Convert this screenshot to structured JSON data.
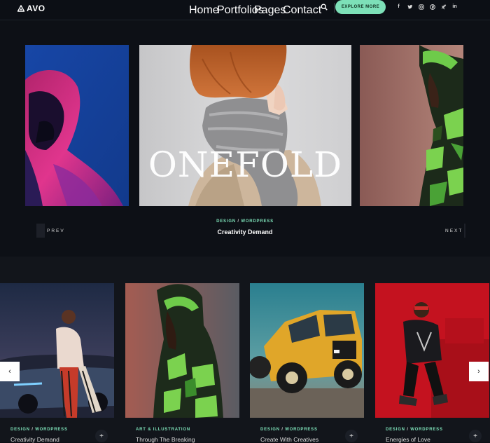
{
  "brand": {
    "logo_text": "AVO"
  },
  "nav": {
    "items": [
      "Home",
      "Portfolios",
      "Pages",
      "Contact"
    ],
    "cta_label": "EXPLORE MORE",
    "socials": [
      "facebook-icon",
      "twitter-icon",
      "instagram-icon",
      "pinterest-icon",
      "xing-icon",
      "linkedin-icon"
    ]
  },
  "hero": {
    "center_overlay": "ONEFOLD",
    "category_1": "DESIGN",
    "separator": "/",
    "category_2": "WORDPRESS",
    "title": "Creativity Demand",
    "prev_label": "PREV",
    "next_label": "NEXT"
  },
  "cards": [
    {
      "cat1": "DESIGN",
      "sep": "/",
      "cat2": "WORDPRESS",
      "title": "Creativity Demand"
    },
    {
      "cat1": "ART & ILLUSTRATION",
      "sep": "",
      "cat2": "",
      "title": "Through The Breaking"
    },
    {
      "cat1": "DESIGN",
      "sep": "/",
      "cat2": "WORDPRESS",
      "title": "Create With Creatives"
    },
    {
      "cat1": "DESIGN",
      "sep": "/",
      "cat2": "WORDPRESS",
      "title": "Energies of Love"
    }
  ],
  "carousel": {
    "prev_glyph": "‹",
    "next_glyph": "›",
    "plus_glyph": "+"
  },
  "colors": {
    "accent": "#7de0b8",
    "background": "#0c0f15"
  }
}
